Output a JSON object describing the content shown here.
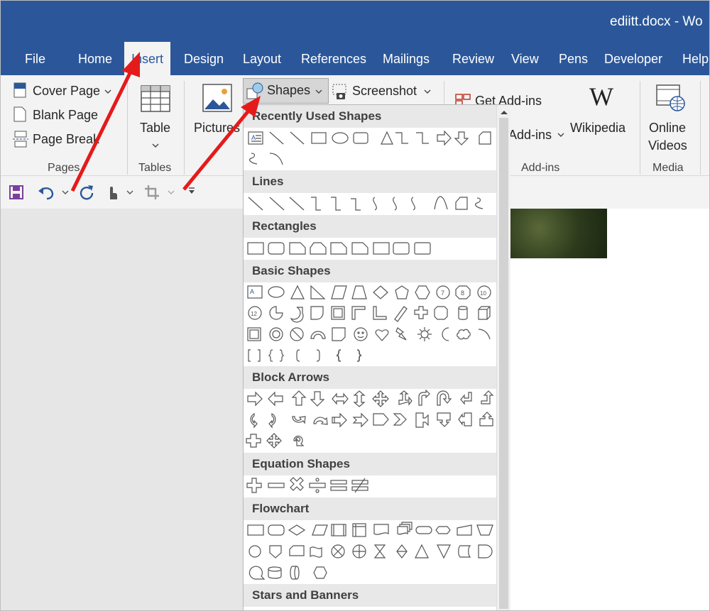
{
  "window": {
    "title": "ediitt.docx  -  Wo"
  },
  "tabs": [
    "File",
    "Home",
    "Insert",
    "Design",
    "Layout",
    "References",
    "Mailings",
    "Review",
    "View",
    "Pens",
    "Developer",
    "Help"
  ],
  "ribbon": {
    "pages": {
      "cover_page": "Cover Page",
      "blank_page": "Blank Page",
      "page_break": "Page Break",
      "label": "Pages"
    },
    "tables": {
      "table": "Table",
      "label": "Tables"
    },
    "illustrations": {
      "pictures": "Pictures",
      "shapes": "Shapes",
      "screenshot": "Screenshot"
    },
    "addins": {
      "get_addins": "Get Add-ins",
      "my_addins": "Add-ins",
      "wikipedia": "Wikipedia",
      "label": "Add-ins"
    },
    "media": {
      "online_videos_line1": "Online",
      "online_videos_line2": "Videos",
      "label": "Media"
    }
  },
  "shapes_menu": {
    "sections": {
      "recent": "Recently Used Shapes",
      "lines": "Lines",
      "rectangles": "Rectangles",
      "basic": "Basic Shapes",
      "block_arrows": "Block Arrows",
      "equation": "Equation Shapes",
      "flowchart": "Flowchart",
      "stars": "Stars and Banners"
    }
  },
  "colors": {
    "title_blue": "#2b579a",
    "ribbon_bg": "#f3f3f3",
    "arrow_red": "#e51a1a",
    "accent_purple": "#7b3f9e"
  }
}
